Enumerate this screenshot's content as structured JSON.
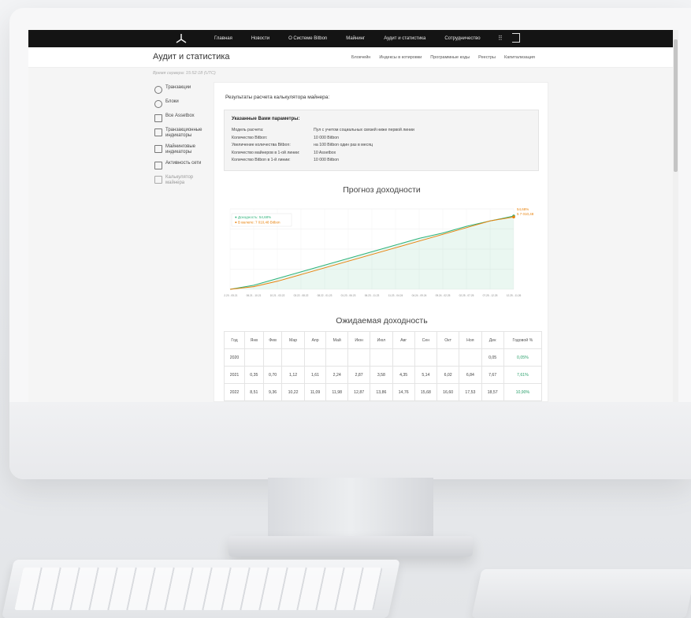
{
  "topnav": {
    "items": [
      "Главная",
      "Новости",
      "О Системе Bitbon",
      "Майнинг",
      "Аудит и статистика",
      "Сотрудничество"
    ]
  },
  "header": {
    "title": "Аудит и статистика",
    "subnav": [
      "Блокчейн",
      "Индексы в котировки",
      "Программные коды",
      "Реестры",
      "Капитализация"
    ],
    "server_time": "Время сервера: 15:52:18 (UTC)"
  },
  "sidebar": {
    "items": [
      {
        "label": "Транзакции",
        "icon": "transactions-icon",
        "active": false
      },
      {
        "label": "Блоки",
        "icon": "blocks-icon",
        "active": false
      },
      {
        "label": "Все Assetbox",
        "icon": "assetbox-icon",
        "active": false
      },
      {
        "label": "Транзакционные индикаторы",
        "icon": "chart-icon",
        "active": false
      },
      {
        "label": "Майнинговые индикаторы",
        "icon": "mining-icon",
        "active": false
      },
      {
        "label": "Активность сети",
        "icon": "network-icon",
        "active": false
      },
      {
        "label": "Калькулятор майнера",
        "icon": "calculator-icon",
        "active": true
      }
    ]
  },
  "results": {
    "title": "Результаты расчета калькулятора майнера:",
    "params_head": "Указанные Вами параметры:",
    "params": [
      {
        "k": "Модель расчета:",
        "v": "Пул с учетом социальных связей ниже первой линии"
      },
      {
        "k": "Количество Bitbon:",
        "v": "10 000 Bitbon"
      },
      {
        "k": "Увеличение количества Bitbon:",
        "v": "на 100 Bitbon один раз в месяц"
      },
      {
        "k": "Количество майнеров в 1-ой линии:",
        "v": "10 Assetbox"
      },
      {
        "k": "Количество Bitbon в 1-й линии:",
        "v": "10 000 Bitbon"
      }
    ]
  },
  "forecast": {
    "title": "Прогноз доходности",
    "legend": [
      {
        "label": "Доходность: 54,68%",
        "color": "#2fb37a"
      },
      {
        "label": "В валюте: 7 010,48 Bitbon",
        "color": "#e8820c"
      }
    ],
    "end_labels": [
      "54,68%",
      "5 7 010,48"
    ]
  },
  "chart_data": {
    "type": "line",
    "title": "Прогноз доходности",
    "x": [
      "12.20 - 05.21",
      "06.21 - 10.21",
      "10.21 - 03.22",
      "03.22 - 08.22",
      "08.22 - 01.23",
      "01.23 - 06.23",
      "06.23 - 11.23",
      "11.23 - 04.24",
      "04.24 - 09.24",
      "09.24 - 02.25",
      "02.25 - 07.25",
      "07.25 - 12.25",
      "12.25 - 11.26"
    ],
    "series": [
      {
        "name": "Доходность: 54,68%",
        "color": "#2fb37a",
        "values": [
          0,
          3,
          8,
          13,
          18,
          23,
          28,
          33,
          38,
          42,
          47,
          51,
          54.68
        ]
      },
      {
        "name": "В валюте: 7 010,48 Bitbon",
        "color": "#e8820c",
        "values": [
          0,
          2,
          6,
          11,
          16,
          21,
          26,
          31,
          36,
          41,
          46,
          51,
          54
        ]
      }
    ],
    "ylim": [
      0,
      60
    ],
    "grid": true,
    "legend_position": "top-left"
  },
  "yield": {
    "title": "Ожидаемая доходность",
    "headers": [
      "Год",
      "Янв",
      "Фев",
      "Мар",
      "Апр",
      "Май",
      "Июн",
      "Июл",
      "Авг",
      "Сен",
      "Окт",
      "Ноя",
      "Дек",
      "Годовой %"
    ],
    "rows": [
      [
        "2020",
        "",
        "",
        "",
        "",
        "",
        "",
        "",
        "",
        "",
        "",
        "",
        "0,05",
        "0,05%"
      ],
      [
        "2021",
        "0,35",
        "0,70",
        "1,12",
        "1,61",
        "2,24",
        "2,87",
        "3,58",
        "4,35",
        "5,14",
        "6,02",
        "6,84",
        "7,67",
        "7,61%"
      ],
      [
        "2022",
        "8,51",
        "9,36",
        "10,22",
        "11,09",
        "11,98",
        "12,87",
        "13,86",
        "14,76",
        "15,68",
        "16,60",
        "17,53",
        "18,57",
        "10,90%"
      ]
    ]
  }
}
